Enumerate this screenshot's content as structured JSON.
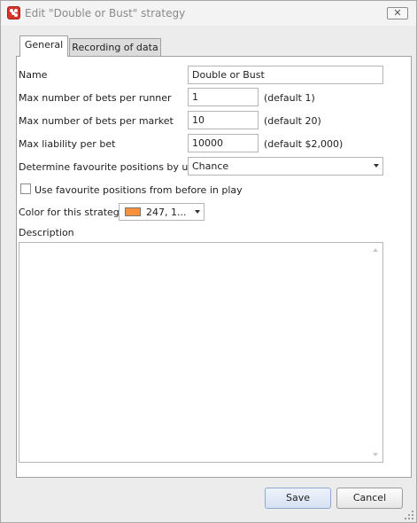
{
  "window": {
    "title": "Edit \"Double or Bust\" strategy",
    "close_label": "✕"
  },
  "tabs": [
    {
      "label": "General",
      "selected": true
    },
    {
      "label": "Recording of data",
      "selected": false
    }
  ],
  "form": {
    "name_label": "Name",
    "name_value": "Double or Bust",
    "max_bets_runner_label": "Max number of bets per runner",
    "max_bets_runner_value": "1",
    "max_bets_runner_hint": "(default 1)",
    "max_bets_market_label": "Max number of bets per market",
    "max_bets_market_value": "10",
    "max_bets_market_hint": "(default 20)",
    "max_liability_label": "Max liability per bet",
    "max_liability_value": "10000",
    "max_liability_hint": "(default $2,000)",
    "fav_positions_label": "Determine favourite positions by using",
    "fav_positions_value": "Chance",
    "use_fav_before_label": "Use favourite positions from before in play",
    "use_fav_before_checked": false,
    "color_label": "Color for this strategy",
    "color_value": "247, 1...",
    "color_swatch": "#f7913b",
    "description_label": "Description",
    "description_value": ""
  },
  "buttons": {
    "save": "Save",
    "cancel": "Cancel"
  }
}
